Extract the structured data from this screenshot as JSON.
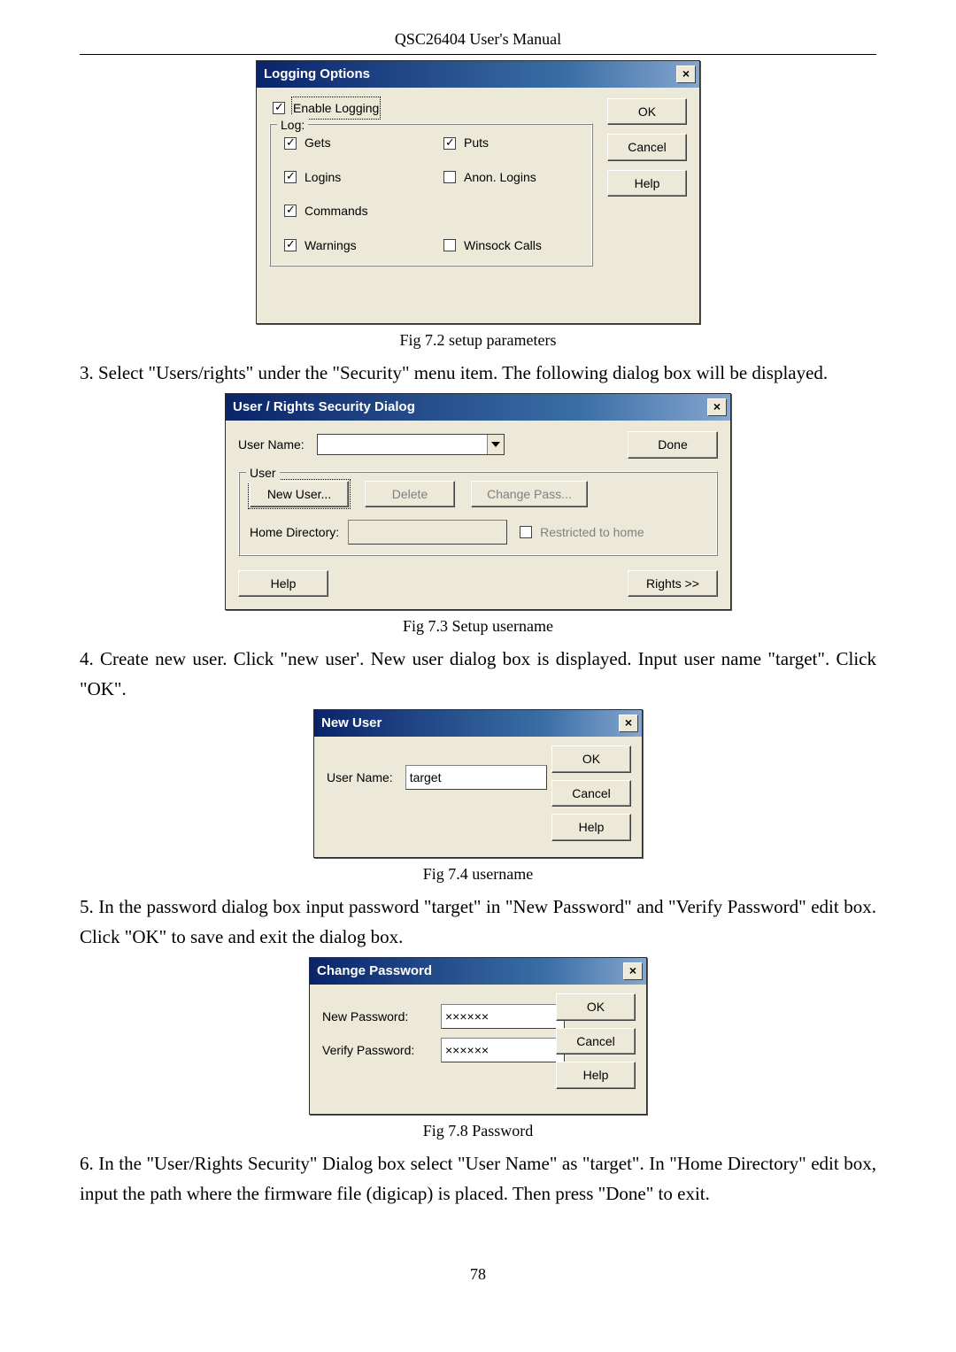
{
  "doc": {
    "header": "QSC26404 User's Manual",
    "cap_7_2": "Fig 7.2 setup parameters",
    "para_3": "3.    Select \"Users/rights\" under the \"Security\" menu item. The following dialog box will be displayed.",
    "cap_7_3": "Fig 7.3 Setup username",
    "para_4": "4.    Create new user. Click \"new user'. New user dialog box is displayed. Input user name \"target\". Click \"OK\".",
    "cap_7_4": "Fig 7.4 username",
    "para_5": "5.    In the password dialog box input password \"target\" in \"New Password\" and   \"Verify Password\" edit box. Click \"OK\" to save and exit the dialog box.",
    "cap_7_8": "Fig 7.8 Password",
    "para_6": "6.    In the \"User/Rights Security\" Dialog box select \"User Name\" as \"target\". In \"Home Directory\" edit box, input the path where the firmware file (digicap) is placed. Then press \"Done\" to exit.",
    "page_number": "78"
  },
  "dlg1": {
    "title": "Logging Options",
    "close": "×",
    "enable": "Enable Logging",
    "group": "Log:",
    "gets": "Gets",
    "puts": "Puts",
    "logins": "Logins",
    "anon": "Anon. Logins",
    "commands": "Commands",
    "warnings": "Warnings",
    "winsock": "Winsock Calls",
    "ok": "OK",
    "cancel": "Cancel",
    "help": "Help"
  },
  "dlg2": {
    "title": "User / Rights Security Dialog",
    "close": "×",
    "username_label": "User Name:",
    "done": "Done",
    "group": "User",
    "newuser": "New User...",
    "delete": "Delete",
    "changepass": "Change Pass...",
    "home_label": "Home Directory:",
    "restricted": "Restricted to home",
    "help": "Help",
    "rights": "Rights >>"
  },
  "dlg3": {
    "title": "New User",
    "close": "×",
    "username_label": "User Name:",
    "username_value": "target",
    "ok": "OK",
    "cancel": "Cancel",
    "help": "Help"
  },
  "dlg4": {
    "title": "Change Password",
    "close": "×",
    "newpw_label": "New Password:",
    "verify_label": "Verify Password:",
    "pw_mask": "××××××",
    "ok": "OK",
    "cancel": "Cancel",
    "help": "Help"
  }
}
